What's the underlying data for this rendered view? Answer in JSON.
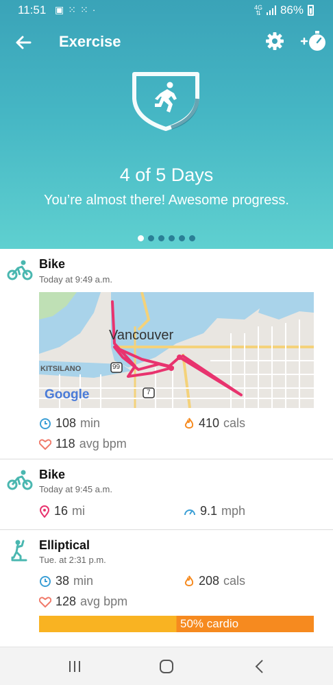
{
  "status_bar": {
    "time": "11:51",
    "battery": "86%",
    "network": "4G"
  },
  "app_bar": {
    "title": "Exercise"
  },
  "goal": {
    "headline": "4 of 5 Days",
    "message": "You’re almost there! Awesome progress.",
    "progress_fraction": 0.8,
    "pager_count": 6,
    "pager_active": 0
  },
  "activities": [
    {
      "type": "Bike",
      "time": "Today at 9:49 a.m.",
      "duration_value": "108",
      "duration_unit": "min",
      "calories_value": "410",
      "calories_unit": "cals",
      "heart_value": "118",
      "heart_unit": "avg bpm",
      "map": {
        "city": "Vancouver",
        "area": "KITSILANO",
        "provider": "Google",
        "route_shield_a": "99",
        "route_shield_b": "7"
      }
    },
    {
      "type": "Bike",
      "time": "Today at 9:45 a.m.",
      "distance_value": "16",
      "distance_unit": "mi",
      "speed_value": "9.1",
      "speed_unit": "mph"
    },
    {
      "type": "Elliptical",
      "time": "Tue. at 2:31 p.m.",
      "duration_value": "38",
      "duration_unit": "min",
      "calories_value": "208",
      "calories_unit": "cals",
      "heart_value": "128",
      "heart_unit": "avg bpm",
      "cardio_label": "50% cardio",
      "cardio_fraction": 0.5
    }
  ],
  "colors": {
    "teal": "#3aa3b8",
    "accent_green": "#4ab7b0",
    "route": "#e8336e",
    "flame": "#f68a1f",
    "cardio_yellow": "#f9b322"
  },
  "icons": [
    "back-arrow-icon",
    "gear-icon",
    "add-timer-icon",
    "running-badge-icon",
    "bike-icon",
    "elliptical-icon",
    "clock-icon",
    "flame-icon",
    "heart-icon",
    "location-pin-icon",
    "speedometer-icon"
  ]
}
